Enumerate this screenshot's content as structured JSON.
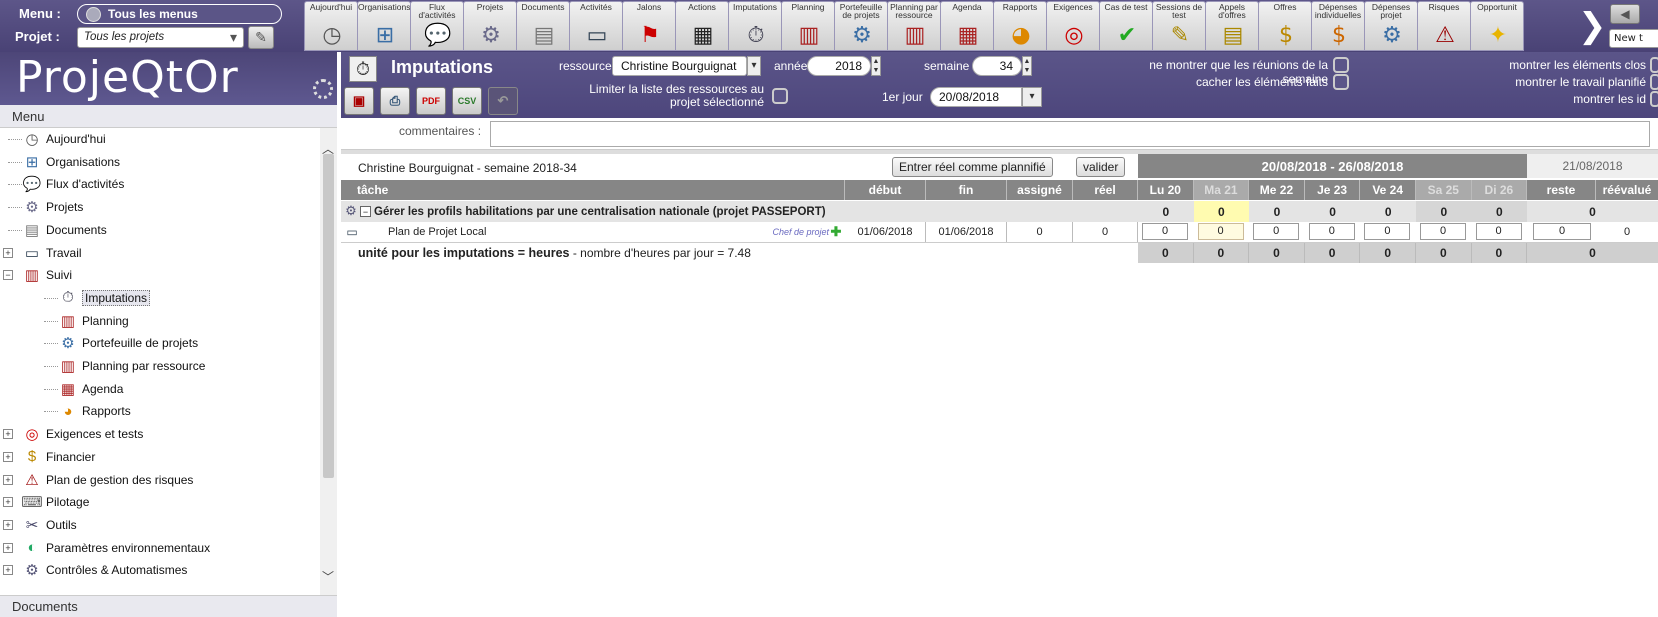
{
  "topbar": {
    "menu_label": "Menu :",
    "menu_value": "Tous les menus",
    "project_label": "Projet :",
    "project_value": "Tous les projets",
    "new_tab": "New t",
    "modules": [
      {
        "label": "Aujourd'hui",
        "icon": "clock-icon"
      },
      {
        "label": "Organisations",
        "icon": "org-icon"
      },
      {
        "label": "Flux d'activités",
        "icon": "chat-icon"
      },
      {
        "label": "Projets",
        "icon": "gear-icon"
      },
      {
        "label": "Documents",
        "icon": "document-icon"
      },
      {
        "label": "Activités",
        "icon": "computer-icon"
      },
      {
        "label": "Jalons",
        "icon": "flag-icon"
      },
      {
        "label": "Actions",
        "icon": "clapper-icon"
      },
      {
        "label": "Imputations",
        "icon": "timesheet-icon"
      },
      {
        "label": "Planning",
        "icon": "planning-icon"
      },
      {
        "label": "Portefeuille de projets",
        "icon": "portfolio-icon"
      },
      {
        "label": "Planning par ressource",
        "icon": "resource-planning-icon"
      },
      {
        "label": "Agenda",
        "icon": "agenda-icon"
      },
      {
        "label": "Rapports",
        "icon": "chart-icon"
      },
      {
        "label": "Exigences",
        "icon": "target-icon"
      },
      {
        "label": "Cas de test",
        "icon": "check-icon"
      },
      {
        "label": "Sessions de test",
        "icon": "test-session-icon"
      },
      {
        "label": "Appels d'offres",
        "icon": "tender-icon"
      },
      {
        "label": "Offres",
        "icon": "money-bag-icon"
      },
      {
        "label": "Dépenses individuelles",
        "icon": "expense-icon"
      },
      {
        "label": "Dépenses projet",
        "icon": "project-expense-icon"
      },
      {
        "label": "Risques",
        "icon": "risk-icon"
      },
      {
        "label": "Opportunit",
        "icon": "bulb-icon"
      }
    ]
  },
  "sidebar": {
    "logo": "ProjeQtOr",
    "menu_header": "Menu",
    "footer_header": "Documents",
    "items": [
      {
        "label": "Aujourd'hui",
        "level": 0,
        "expander": "",
        "icon": "clock-icon"
      },
      {
        "label": "Organisations",
        "level": 0,
        "expander": "",
        "icon": "org-icon"
      },
      {
        "label": "Flux d'activités",
        "level": 0,
        "expander": "",
        "icon": "chat-icon"
      },
      {
        "label": "Projets",
        "level": 0,
        "expander": "",
        "icon": "gear-icon"
      },
      {
        "label": "Documents",
        "level": 0,
        "expander": "",
        "icon": "document-icon"
      },
      {
        "label": "Travail",
        "level": 0,
        "expander": "+",
        "icon": "computer-icon"
      },
      {
        "label": "Suivi",
        "level": 0,
        "expander": "−",
        "icon": "planning-icon"
      },
      {
        "label": "Imputations",
        "level": 1,
        "expander": "",
        "icon": "timesheet-icon",
        "selected": true
      },
      {
        "label": "Planning",
        "level": 1,
        "expander": "",
        "icon": "planning-icon"
      },
      {
        "label": "Portefeuille de projets",
        "level": 1,
        "expander": "",
        "icon": "portfolio-icon"
      },
      {
        "label": "Planning par ressource",
        "level": 1,
        "expander": "",
        "icon": "resource-planning-icon"
      },
      {
        "label": "Agenda",
        "level": 1,
        "expander": "",
        "icon": "agenda-icon"
      },
      {
        "label": "Rapports",
        "level": 1,
        "expander": "",
        "icon": "chart-icon"
      },
      {
        "label": "Exigences et tests",
        "level": 0,
        "expander": "+",
        "icon": "target-icon"
      },
      {
        "label": "Financier",
        "level": 0,
        "expander": "+",
        "icon": "money-bag-icon"
      },
      {
        "label": "Plan de gestion des risques",
        "level": 0,
        "expander": "+",
        "icon": "risk-icon"
      },
      {
        "label": "Pilotage",
        "level": 0,
        "expander": "+",
        "icon": "pilot-icon"
      },
      {
        "label": "Outils",
        "level": 0,
        "expander": "+",
        "icon": "tools-icon"
      },
      {
        "label": "Paramètres environnementaux",
        "level": 0,
        "expander": "+",
        "icon": "env-icon"
      },
      {
        "label": "Contrôles & Automatismes",
        "level": 0,
        "expander": "+",
        "icon": "automation-icon"
      }
    ]
  },
  "main": {
    "title": "Imputations",
    "resource_label": "ressource",
    "resource_value": "Christine Bourguignat",
    "year_label": "année",
    "year_value": "2018",
    "week_label": "semaine",
    "week_value": "34",
    "limit_label_1": "Limiter la liste des ressources au",
    "limit_label_2": "projet sélectionné",
    "first_day_label": "1er jour",
    "first_day_value": "20/08/2018",
    "opt_meetings": "ne montrer que les réunions de la semaine",
    "opt_hide_done": "cacher les éléments faits",
    "opt_closed": "montrer les éléments clos",
    "opt_planned": "montrer le travail planifié",
    "opt_ids": "montrer les id",
    "comments_label": "commentaires :",
    "toolbar": {
      "save": "save-icon",
      "print": "print-icon",
      "pdf_label": "PDF",
      "csv_label": "CSV",
      "undo": "undo-icon"
    }
  },
  "grid": {
    "caption": "Christine Bourguignat - semaine 2018-34",
    "btn_real_planned": "Entrer réel comme plannifié",
    "btn_validate": "valider",
    "week_range": "20/08/2018 - 26/08/2018",
    "next_date": "21/08/2018",
    "col_task": "tâche",
    "col_start": "début",
    "col_end": "fin",
    "col_assigned": "assigné",
    "col_real": "réel",
    "days": [
      "Lu 20",
      "Ma 21",
      "Me 22",
      "Je 23",
      "Ve 24",
      "Sa 25",
      "Di 26"
    ],
    "col_remaining": "reste",
    "col_reevaluated": "réévalué",
    "project_row": {
      "name": "Gérer les profils habilitations par une centralisation nationale (projet PASSEPORT)",
      "day_values": [
        "0",
        "0",
        "0",
        "0",
        "0",
        "0",
        "0"
      ],
      "remaining": "0"
    },
    "task_row": {
      "name": "Plan de Projet Local",
      "role": "Chef de projet",
      "start": "01/06/2018",
      "end": "01/06/2018",
      "assigned": "0",
      "real": "0",
      "day_values": [
        "0",
        "0",
        "0",
        "0",
        "0",
        "0",
        "0"
      ],
      "remaining": "0",
      "reevaluated": "0"
    },
    "footer": {
      "unit_bold": "unité pour les imputations = heures",
      "unit_rest": " - nombre d'heures par jour = 7.48",
      "day_totals": [
        "0",
        "0",
        "0",
        "0",
        "0",
        "0",
        "0"
      ],
      "remaining": "0"
    }
  },
  "colors": {
    "header_purple": "#4d467c",
    "grid_header": "#868686",
    "today_highlight": "#fffbe0"
  }
}
